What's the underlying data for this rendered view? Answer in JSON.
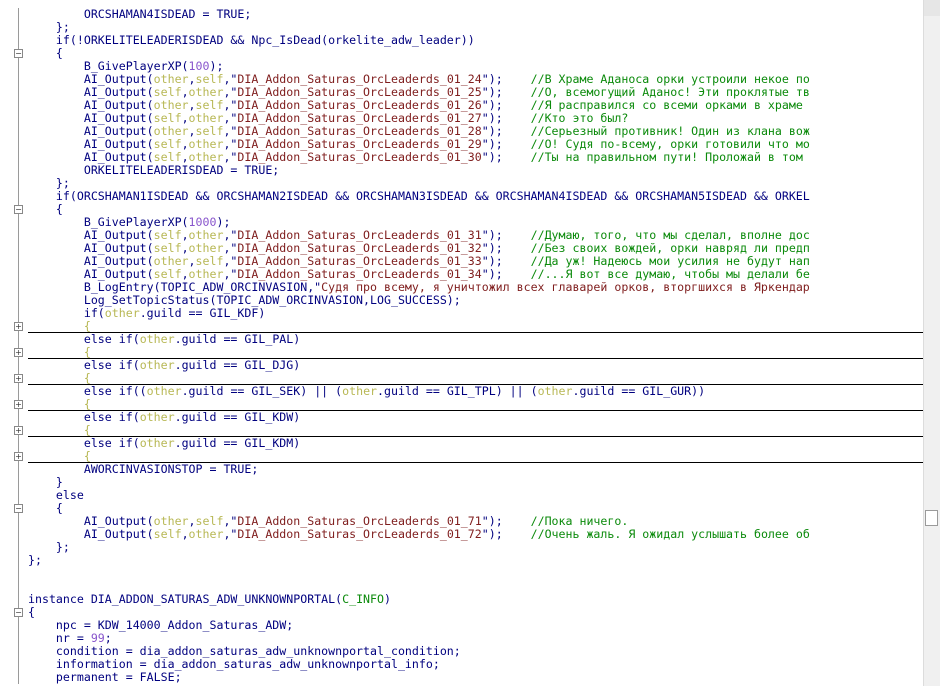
{
  "editor": {
    "lines": [
      {
        "segs": [
          [
            "k",
            "        ORCSHAMAN4ISDEAD = TRUE;"
          ]
        ]
      },
      {
        "segs": [
          [
            "k",
            "    };"
          ]
        ]
      },
      {
        "segs": [
          [
            "k",
            "    if(!ORKELITELEADERISDEAD && Npc_IsDead(orkelite_adw_leader))"
          ]
        ]
      },
      {
        "segs": [
          [
            "k",
            "    {"
          ]
        ],
        "fold": "-"
      },
      {
        "segs": [
          [
            "k",
            "        B_GivePlayerXP("
          ],
          [
            "n",
            "100"
          ],
          [
            "k",
            ");"
          ]
        ]
      },
      {
        "segs": [
          [
            "k",
            "        AI_Output("
          ],
          [
            "v",
            "other"
          ],
          [
            "k",
            ","
          ],
          [
            "v",
            "self"
          ],
          [
            "k",
            ",\""
          ],
          [
            "s",
            "DIA_Addon_Saturas_OrcLeaderds_01_24"
          ],
          [
            "k",
            "\");    "
          ],
          [
            "c",
            "//В Храме Аданоса орки устроили некое по"
          ]
        ]
      },
      {
        "segs": [
          [
            "k",
            "        AI_Output("
          ],
          [
            "v",
            "self"
          ],
          [
            "k",
            ","
          ],
          [
            "v",
            "other"
          ],
          [
            "k",
            ",\""
          ],
          [
            "s",
            "DIA_Addon_Saturas_OrcLeaderds_01_25"
          ],
          [
            "k",
            "\");    "
          ],
          [
            "c",
            "//О, всемогущий Аданос! Эти проклятые тв"
          ]
        ]
      },
      {
        "segs": [
          [
            "k",
            "        AI_Output("
          ],
          [
            "v",
            "other"
          ],
          [
            "k",
            ","
          ],
          [
            "v",
            "self"
          ],
          [
            "k",
            ",\""
          ],
          [
            "s",
            "DIA_Addon_Saturas_OrcLeaderds_01_26"
          ],
          [
            "k",
            "\");    "
          ],
          [
            "c",
            "//Я расправился со всеми орками в храме"
          ]
        ]
      },
      {
        "segs": [
          [
            "k",
            "        AI_Output("
          ],
          [
            "v",
            "self"
          ],
          [
            "k",
            ","
          ],
          [
            "v",
            "other"
          ],
          [
            "k",
            ",\""
          ],
          [
            "s",
            "DIA_Addon_Saturas_OrcLeaderds_01_27"
          ],
          [
            "k",
            "\");    "
          ],
          [
            "c",
            "//Кто это был?"
          ]
        ]
      },
      {
        "segs": [
          [
            "k",
            "        AI_Output("
          ],
          [
            "v",
            "other"
          ],
          [
            "k",
            ","
          ],
          [
            "v",
            "self"
          ],
          [
            "k",
            ",\""
          ],
          [
            "s",
            "DIA_Addon_Saturas_OrcLeaderds_01_28"
          ],
          [
            "k",
            "\");    "
          ],
          [
            "c",
            "//Серьезный противник! Один из клана вож"
          ]
        ]
      },
      {
        "segs": [
          [
            "k",
            "        AI_Output("
          ],
          [
            "v",
            "self"
          ],
          [
            "k",
            ","
          ],
          [
            "v",
            "other"
          ],
          [
            "k",
            ",\""
          ],
          [
            "s",
            "DIA_Addon_Saturas_OrcLeaderds_01_29"
          ],
          [
            "k",
            "\");    "
          ],
          [
            "c",
            "//О! Судя по-всему, орки готовили что мо"
          ]
        ]
      },
      {
        "segs": [
          [
            "k",
            "        AI_Output("
          ],
          [
            "v",
            "self"
          ],
          [
            "k",
            ","
          ],
          [
            "v",
            "other"
          ],
          [
            "k",
            ",\""
          ],
          [
            "s",
            "DIA_Addon_Saturas_OrcLeaderds_01_30"
          ],
          [
            "k",
            "\");    "
          ],
          [
            "c",
            "//Ты на правильном пути! Проложай в том"
          ]
        ]
      },
      {
        "segs": [
          [
            "k",
            "        ORKELITELEADERISDEAD = TRUE;"
          ]
        ]
      },
      {
        "segs": [
          [
            "k",
            "    };"
          ]
        ]
      },
      {
        "segs": [
          [
            "k",
            "    if(ORCSHAMAN1ISDEAD && ORCSHAMAN2ISDEAD && ORCSHAMAN3ISDEAD && ORCSHAMAN4ISDEAD && ORCSHAMAN5ISDEAD && ORKEL"
          ]
        ]
      },
      {
        "segs": [
          [
            "k",
            "    {"
          ]
        ],
        "fold": "-"
      },
      {
        "segs": [
          [
            "k",
            "        B_GivePlayerXP("
          ],
          [
            "n",
            "1000"
          ],
          [
            "k",
            ");"
          ]
        ]
      },
      {
        "segs": [
          [
            "k",
            "        AI_Output("
          ],
          [
            "v",
            "self"
          ],
          [
            "k",
            ","
          ],
          [
            "v",
            "other"
          ],
          [
            "k",
            ",\""
          ],
          [
            "s",
            "DIA_Addon_Saturas_OrcLeaderds_01_31"
          ],
          [
            "k",
            "\");    "
          ],
          [
            "c",
            "//Думаю, того, что мы сделал, вполне дос"
          ]
        ]
      },
      {
        "segs": [
          [
            "k",
            "        AI_Output("
          ],
          [
            "v",
            "self"
          ],
          [
            "k",
            ","
          ],
          [
            "v",
            "other"
          ],
          [
            "k",
            ",\""
          ],
          [
            "s",
            "DIA_Addon_Saturas_OrcLeaderds_01_32"
          ],
          [
            "k",
            "\");    "
          ],
          [
            "c",
            "//Без своих вождей, орки навряд ли предп"
          ]
        ]
      },
      {
        "segs": [
          [
            "k",
            "        AI_Output("
          ],
          [
            "v",
            "other"
          ],
          [
            "k",
            ","
          ],
          [
            "v",
            "self"
          ],
          [
            "k",
            ",\""
          ],
          [
            "s",
            "DIA_Addon_Saturas_OrcLeaderds_01_33"
          ],
          [
            "k",
            "\");    "
          ],
          [
            "c",
            "//Да уж! Надеюсь мои усилия не будут нап"
          ]
        ]
      },
      {
        "segs": [
          [
            "k",
            "        AI_Output("
          ],
          [
            "v",
            "self"
          ],
          [
            "k",
            ","
          ],
          [
            "v",
            "other"
          ],
          [
            "k",
            ",\""
          ],
          [
            "s",
            "DIA_Addon_Saturas_OrcLeaderds_01_34"
          ],
          [
            "k",
            "\");    "
          ],
          [
            "c",
            "//...Я вот все думаю, чтобы мы делали бе"
          ]
        ]
      },
      {
        "segs": [
          [
            "k",
            "        B_LogEntry(TOPIC_ADW_ORCINVASION,\""
          ],
          [
            "s",
            "Судя про всему, я уничтожил всех главарей орков, вторгшихся в Яркендар"
          ]
        ]
      },
      {
        "segs": [
          [
            "k",
            "        Log_SetTopicStatus(TOPIC_ADW_ORCINVASION,LOG_SUCCESS);"
          ]
        ]
      },
      {
        "segs": [
          [
            "k",
            "        if("
          ],
          [
            "v",
            "other"
          ],
          [
            "k",
            ".guild == GIL_KDF)"
          ]
        ]
      },
      {
        "segs": [
          [
            "v",
            "        {"
          ]
        ],
        "fold": "+",
        "sep": true
      },
      {
        "segs": [
          [
            "k",
            "        else if("
          ],
          [
            "v",
            "other"
          ],
          [
            "k",
            ".guild == GIL_PAL)"
          ]
        ]
      },
      {
        "segs": [
          [
            "v",
            "        {"
          ]
        ],
        "fold": "+",
        "sep": true
      },
      {
        "segs": [
          [
            "k",
            "        else if("
          ],
          [
            "v",
            "other"
          ],
          [
            "k",
            ".guild == GIL_DJG)"
          ]
        ]
      },
      {
        "segs": [
          [
            "v",
            "        {"
          ]
        ],
        "fold": "+",
        "sep": true
      },
      {
        "segs": [
          [
            "k",
            "        else if(("
          ],
          [
            "v",
            "other"
          ],
          [
            "k",
            ".guild == GIL_SEK) || ("
          ],
          [
            "v",
            "other"
          ],
          [
            "k",
            ".guild == GIL_TPL) || ("
          ],
          [
            "v",
            "other"
          ],
          [
            "k",
            ".guild == GIL_GUR))"
          ]
        ]
      },
      {
        "segs": [
          [
            "v",
            "        {"
          ]
        ],
        "fold": "+",
        "sep": true
      },
      {
        "segs": [
          [
            "k",
            "        else if("
          ],
          [
            "v",
            "other"
          ],
          [
            "k",
            ".guild == GIL_KDW)"
          ]
        ]
      },
      {
        "segs": [
          [
            "v",
            "        {"
          ]
        ],
        "fold": "+",
        "sep": true
      },
      {
        "segs": [
          [
            "k",
            "        else if("
          ],
          [
            "v",
            "other"
          ],
          [
            "k",
            ".guild == GIL_KDM)"
          ]
        ]
      },
      {
        "segs": [
          [
            "v",
            "        {"
          ]
        ],
        "fold": "+",
        "sep": true
      },
      {
        "segs": [
          [
            "k",
            "        AWORCINVASIONSTOP = TRUE;"
          ]
        ]
      },
      {
        "segs": [
          [
            "k",
            "    }"
          ]
        ]
      },
      {
        "segs": [
          [
            "k",
            "    else"
          ]
        ]
      },
      {
        "segs": [
          [
            "k",
            "    {"
          ]
        ],
        "fold": "-"
      },
      {
        "segs": [
          [
            "k",
            "        AI_Output("
          ],
          [
            "v",
            "other"
          ],
          [
            "k",
            ","
          ],
          [
            "v",
            "self"
          ],
          [
            "k",
            ",\""
          ],
          [
            "s",
            "DIA_Addon_Saturas_OrcLeaderds_01_71"
          ],
          [
            "k",
            "\");    "
          ],
          [
            "c",
            "//Пока ничего."
          ]
        ]
      },
      {
        "segs": [
          [
            "k",
            "        AI_Output("
          ],
          [
            "v",
            "self"
          ],
          [
            "k",
            ","
          ],
          [
            "v",
            "other"
          ],
          [
            "k",
            ",\""
          ],
          [
            "s",
            "DIA_Addon_Saturas_OrcLeaderds_01_72"
          ],
          [
            "k",
            "\");    "
          ],
          [
            "c",
            "//Очень жаль. Я ожидал услышать более об"
          ]
        ]
      },
      {
        "segs": [
          [
            "k",
            "    };"
          ]
        ]
      },
      {
        "segs": [
          [
            "k",
            "};"
          ]
        ]
      },
      {
        "segs": [
          [
            "k",
            ""
          ]
        ]
      },
      {
        "segs": [
          [
            "k",
            ""
          ]
        ]
      },
      {
        "segs": [
          [
            "k",
            "instance DIA_ADDON_SATURAS_ADW_UNKNOWNPORTAL("
          ],
          [
            "c",
            "C_INFO"
          ],
          [
            "k",
            ")"
          ]
        ]
      },
      {
        "segs": [
          [
            "k",
            "{"
          ]
        ],
        "fold": "-"
      },
      {
        "segs": [
          [
            "k",
            "    npc = KDW_14000_Addon_Saturas_ADW;"
          ]
        ]
      },
      {
        "segs": [
          [
            "k",
            "    nr = "
          ],
          [
            "n",
            "99"
          ],
          [
            "k",
            ";"
          ]
        ]
      },
      {
        "segs": [
          [
            "k",
            "    condition = dia_addon_saturas_adw_unknownportal_condition;"
          ]
        ]
      },
      {
        "segs": [
          [
            "k",
            "    information = dia_addon_saturas_adw_unknownportal_info;"
          ]
        ]
      },
      {
        "segs": [
          [
            "k",
            "    permanent = FALSE;"
          ]
        ]
      }
    ]
  }
}
